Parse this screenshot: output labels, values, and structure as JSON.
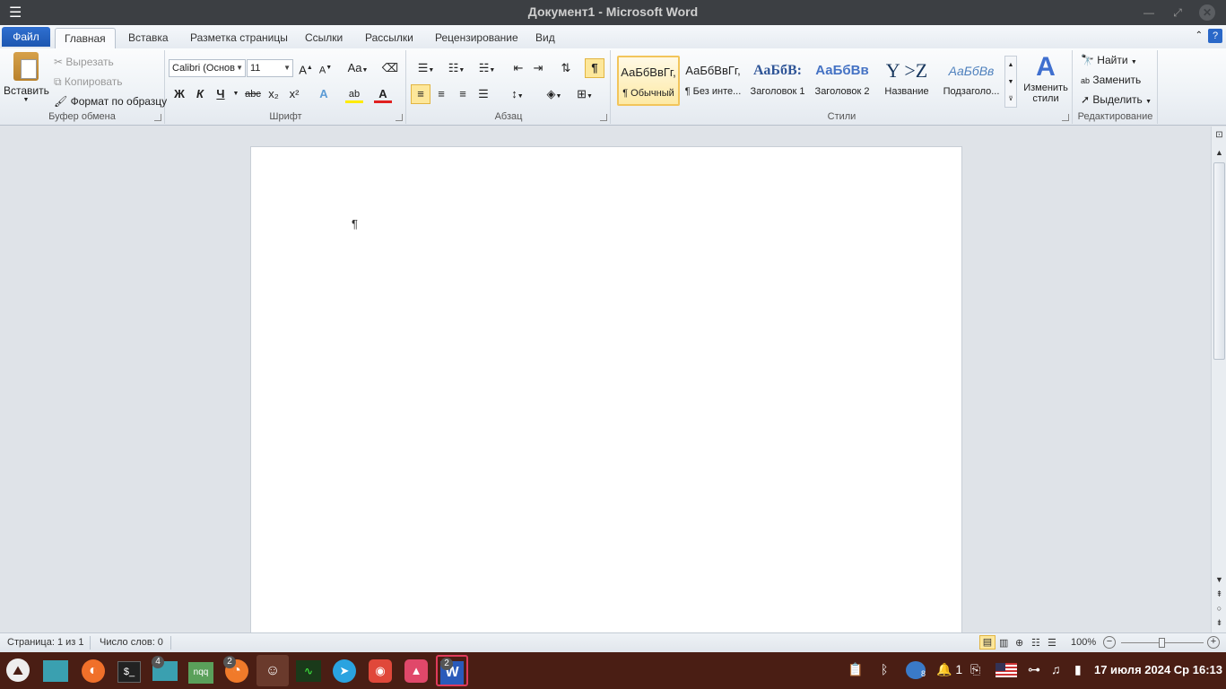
{
  "window": {
    "title": "Документ1 - Microsoft Word",
    "menu_icon": "hamburger-icon",
    "minimize_icon": "minimize-icon",
    "maximize_icon": "maximize-icon",
    "close_icon": "close-icon"
  },
  "tabs": [
    {
      "label": "Файл"
    },
    {
      "label": "Главная"
    },
    {
      "label": "Вставка"
    },
    {
      "label": "Разметка страницы"
    },
    {
      "label": "Ссылки"
    },
    {
      "label": "Рассылки"
    },
    {
      "label": "Рецензирование"
    },
    {
      "label": "Вид"
    }
  ],
  "active_tab": "Главная",
  "clipboard": {
    "label": "Буфер обмена",
    "paste": "Вставить",
    "cut": "Вырезать",
    "copy": "Копировать",
    "format_painter": "Формат по образцу"
  },
  "font": {
    "label": "Шрифт",
    "name": "Calibri (Основ",
    "size": "11",
    "bold": "Ж",
    "italic": "К",
    "underline": "Ч",
    "strike": "abc",
    "subscript": "x₂",
    "superscript": "x²",
    "grow": "A",
    "shrink": "A",
    "case": "Aa"
  },
  "paragraph": {
    "label": "Абзац",
    "show_marks": "¶"
  },
  "styles": {
    "label": "Стили",
    "items": [
      {
        "preview": "АаБбВвГг,",
        "name": "¶ Обычный"
      },
      {
        "preview": "АаБбВвГг,",
        "name": "¶ Без инте..."
      },
      {
        "preview": "АаБбВ:",
        "name": "Заголовок 1"
      },
      {
        "preview": "АаБбВв",
        "name": "Заголовок 2"
      },
      {
        "preview": "Y >Z",
        "name": "Название"
      },
      {
        "preview": "АаБбВв",
        "name": "Подзаголо..."
      }
    ],
    "change": "Изменить стили"
  },
  "editing": {
    "label": "Редактирование",
    "find": "Найти",
    "replace": "Заменить",
    "select": "Выделить"
  },
  "document": {
    "pilcrow": "¶"
  },
  "status": {
    "page": "Страница: 1 из 1",
    "words": "Число слов: 0",
    "zoom": "100%"
  },
  "taskbar": {
    "items": [
      {
        "icon": "start-menu-icon"
      },
      {
        "icon": "desktop-icon"
      },
      {
        "icon": "firefox-icon"
      },
      {
        "icon": "terminal-icon"
      },
      {
        "icon": "file-manager-icon",
        "badge": "4"
      },
      {
        "icon": "nqq-icon",
        "text": "nqq"
      },
      {
        "icon": "app-icon",
        "badge": "2"
      },
      {
        "icon": "emoji-icon"
      },
      {
        "icon": "system-monitor-icon"
      },
      {
        "icon": "telegram-icon"
      },
      {
        "icon": "game-icon"
      },
      {
        "icon": "image-viewer-icon"
      },
      {
        "icon": "word-icon",
        "badge": "2"
      }
    ],
    "tray": {
      "notifications_count": "1",
      "badge_8": "8",
      "clock": "17 июля 2024 Ср 16:13"
    }
  },
  "colors": {
    "file_tab": "#2a68c8",
    "taskbar": "#4a1e14",
    "titlebar": "#3c3f43",
    "highlight": "#fde79a"
  }
}
